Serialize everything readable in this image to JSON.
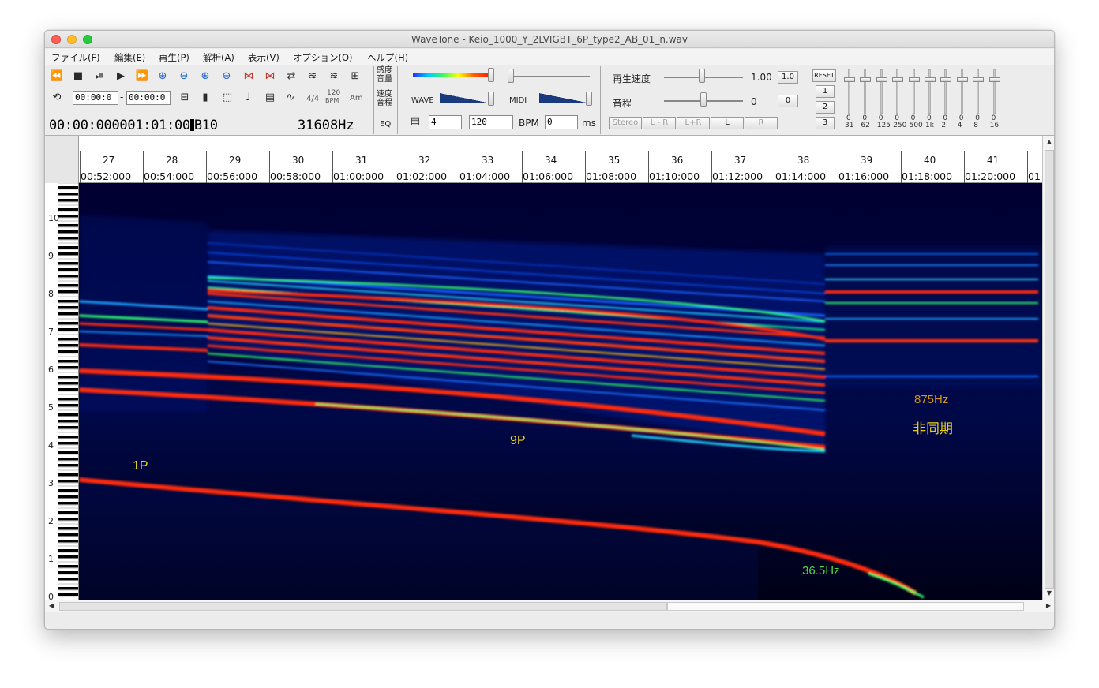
{
  "window": {
    "title": "WaveTone - Keio_1000_Y_2LVIGBT_6P_type2_AB_01_n.wav"
  },
  "menu": [
    "ファイル(F)",
    "編集(E)",
    "再生(P)",
    "解析(A)",
    "表示(V)",
    "オプション(O)",
    "ヘルプ(H)"
  ],
  "toolbar": {
    "row1_icons": [
      "rewind-icon",
      "stop-icon",
      "step-icon",
      "play-icon",
      "fast-forward-icon",
      "zoom-in-h-icon",
      "zoom-out-h-icon",
      "zoom-in-v-icon",
      "zoom-out-v-icon",
      "fit-h-icon",
      "fit-v-icon",
      "repeat-icon",
      "waveform-icon",
      "waveform-alt-icon",
      "book-icon"
    ],
    "range_start": "00:00:0",
    "range_sep": "-",
    "range_end": "00:00:0",
    "time_sig": "4/4",
    "bpm_top": "120",
    "bpm_bottom": "BPM",
    "chord": "Am",
    "current_time": "00:00:000001:01:00",
    "cursor_note": "B10",
    "frequency": "31608Hz",
    "eq_label": "EQ",
    "sensitivity_label_1": "感度",
    "sensitivity_label_2": "音量",
    "speed_label_1": "速度",
    "speed_label_2": "音程",
    "wave_label": "WAVE",
    "midi_label": "MIDI",
    "grid_value": "4",
    "bpm_value": "120",
    "bpm_label": "BPM",
    "ms_value": "0",
    "ms_label": "ms",
    "playback_speed_label": "再生速度",
    "playback_speed_value": "1.00",
    "playback_speed_reset": "1.0",
    "pitch_label": "音程",
    "pitch_value": "0",
    "pitch_reset": "0",
    "channel_buttons": [
      "Stereo",
      "L - R",
      "L+R",
      "L",
      "R"
    ],
    "reset_label": "RESET",
    "preset_buttons": [
      "1",
      "2",
      "3"
    ],
    "eq_bands": [
      {
        "label": "31",
        "value": "0"
      },
      {
        "label": "62",
        "value": "0"
      },
      {
        "label": "125",
        "value": "0"
      },
      {
        "label": "250",
        "value": "0"
      },
      {
        "label": "500",
        "value": "0"
      },
      {
        "label": "1k",
        "value": "0"
      },
      {
        "label": "2",
        "value": "0"
      },
      {
        "label": "4",
        "value": "0"
      },
      {
        "label": "8",
        "value": "0"
      },
      {
        "label": "16",
        "value": "0"
      }
    ]
  },
  "ruler": {
    "bars": [
      "27",
      "28",
      "29",
      "30",
      "31",
      "32",
      "33",
      "34",
      "35",
      "36",
      "37",
      "38",
      "39",
      "40",
      "41"
    ],
    "times": [
      "00:52:000",
      "00:54:000",
      "00:56:000",
      "00:58:000",
      "01:00:000",
      "01:02:000",
      "01:04:000",
      "01:06:000",
      "01:08:000",
      "01:10:000",
      "01:12:000",
      "01:14:000",
      "01:16:000",
      "01:18:000",
      "01:20:000",
      "01"
    ]
  },
  "keyboard": {
    "octaves": [
      "10",
      "9",
      "8",
      "7",
      "6",
      "5",
      "4",
      "3",
      "2",
      "1",
      "0"
    ]
  },
  "annotations": {
    "p1": "1P",
    "p9": "9P",
    "f875": "875Hz",
    "async": "非同期",
    "f365": "36.5Hz"
  },
  "colors": {
    "annotation_yellow": "#e8d018",
    "annotation_orange": "#d0921a",
    "annotation_green": "#4fd83a",
    "spectrogram_bg": "#00001a",
    "line_hot": "#ff2a10"
  }
}
